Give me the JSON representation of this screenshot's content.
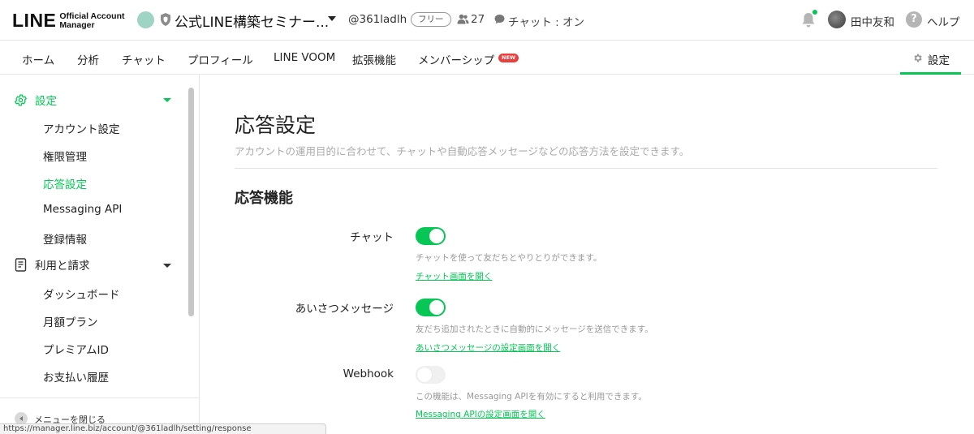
{
  "header": {
    "logo_main": "LINE",
    "logo_sub_1": "Official Account",
    "logo_sub_2": "Manager",
    "account_name": "公式LINE構築セミナー...",
    "account_id": "@361ladlh",
    "plan_badge": "フリー",
    "friends_count": "27",
    "chat_status": "チャット : オン",
    "user_name": "田中友和",
    "help_label": "ヘルプ"
  },
  "nav": {
    "tabs": [
      {
        "label": "ホーム"
      },
      {
        "label": "分析"
      },
      {
        "label": "チャット"
      },
      {
        "label": "プロフィール"
      },
      {
        "label": "LINE VOOM"
      },
      {
        "label": "拡張機能"
      },
      {
        "label": "メンバーシップ"
      }
    ],
    "new_badge": "NEW",
    "settings_label": "設定"
  },
  "sidebar": {
    "group_settings": "設定",
    "settings_items": [
      {
        "label": "アカウント設定"
      },
      {
        "label": "権限管理"
      },
      {
        "label": "応答設定"
      },
      {
        "label": "Messaging API"
      },
      {
        "label": "登録情報"
      }
    ],
    "group_billing": "利用と請求",
    "billing_items": [
      {
        "label": "ダッシュボード"
      },
      {
        "label": "月額プラン"
      },
      {
        "label": "プレミアムID"
      },
      {
        "label": "お支払い履歴"
      }
    ],
    "collapse_label": "メニューを閉じる"
  },
  "status_url": "https://manager.line.biz/account/@361ladlh/setting/response",
  "main": {
    "page_title": "応答設定",
    "page_description": "アカウントの運用目的に合わせて、チャットや自動応答メッセージなどの応答方法を設定できます。",
    "section_title": "応答機能",
    "rows": [
      {
        "label": "チャット",
        "enabled": true,
        "description": "チャットを使って友だちとやりとりができます。",
        "link": "チャット画面を開く"
      },
      {
        "label": "あいさつメッセージ",
        "enabled": true,
        "description": "友だち追加されたときに自動的にメッセージを送信できます。",
        "link": "あいさつメッセージの設定画面を開く"
      },
      {
        "label": "Webhook",
        "enabled": false,
        "description": "この機能は、Messaging APIを有効にすると利用できます。",
        "link": "Messaging APIの設定画面を開く"
      }
    ]
  },
  "colors": {
    "accent": "#06c755",
    "new_badge": "#e9403e"
  }
}
